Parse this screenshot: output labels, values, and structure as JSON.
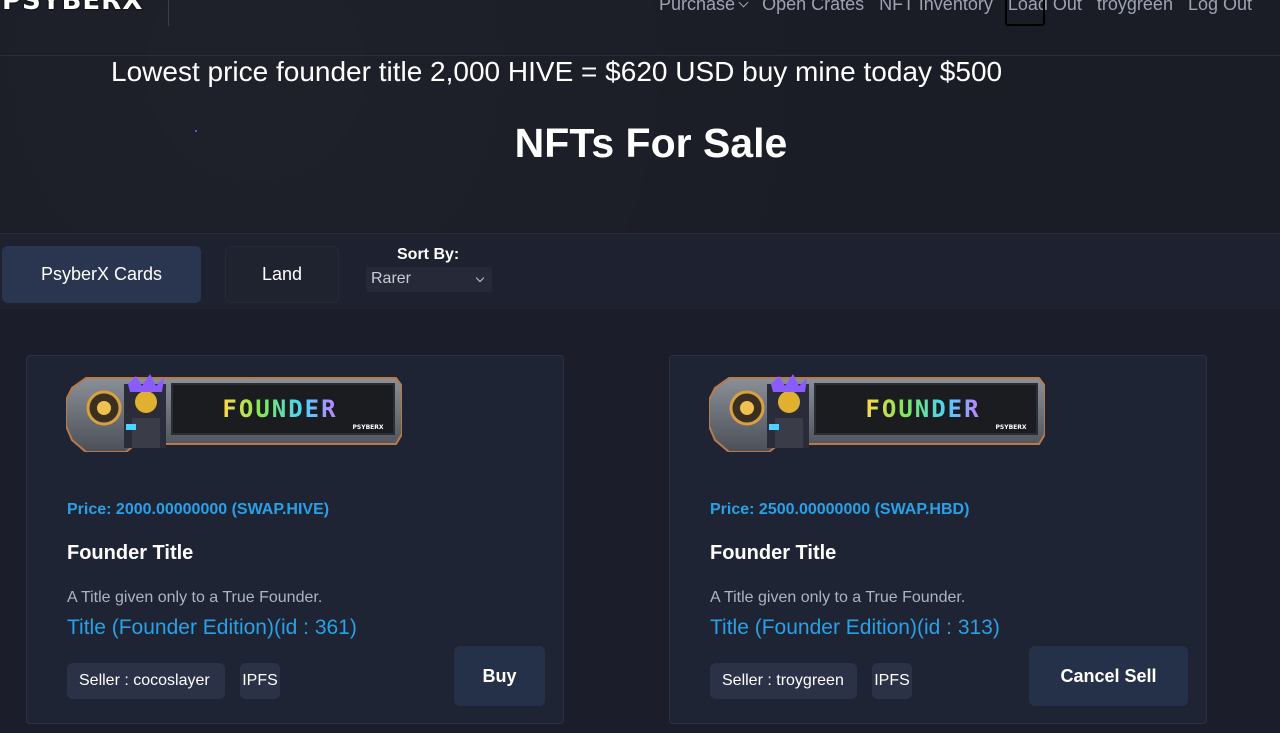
{
  "nav": {
    "logo": "PSYBERX",
    "links": [
      {
        "label": "Purchase"
      },
      {
        "label": "Open Crates"
      },
      {
        "label": "NFT Inventory"
      },
      {
        "label": "Load Out"
      },
      {
        "label": "troygreen"
      },
      {
        "label": "Log Out"
      }
    ]
  },
  "promo": "Lowest price founder title 2,000 HIVE = $620 USD buy mine today $500",
  "page_title": "NFTs For Sale",
  "filters": {
    "tabs": [
      "PsyberX Cards",
      "Land"
    ],
    "sort_label": "Sort By:",
    "sort_value": "Rarer"
  },
  "cards": [
    {
      "banner_text": "FOUNDER",
      "banner_brand": "PSYBERX",
      "price": "Price: 2000.00000000 (SWAP.HIVE)",
      "title": "Founder Title",
      "description": "A Title given only to a True Founder.",
      "link": "Title (Founder Edition)(id : 361)",
      "seller": "Seller : cocoslayer",
      "ipfs": "IPFS",
      "action": "Buy"
    },
    {
      "banner_text": "FOUNDER",
      "banner_brand": "PSYBERX",
      "price": "Price: 2500.00000000 (SWAP.HBD)",
      "title": "Founder Title",
      "description": "A Title given only to a True Founder.",
      "link": "Title (Founder Edition)(id : 313)",
      "seller": "Seller : troygreen",
      "ipfs": "IPFS",
      "action": "Cancel Sell"
    }
  ],
  "colors": {
    "accent": "#2aa0e6",
    "background": "#1b1e2a",
    "card": "#1f2435",
    "button": "#253049"
  }
}
